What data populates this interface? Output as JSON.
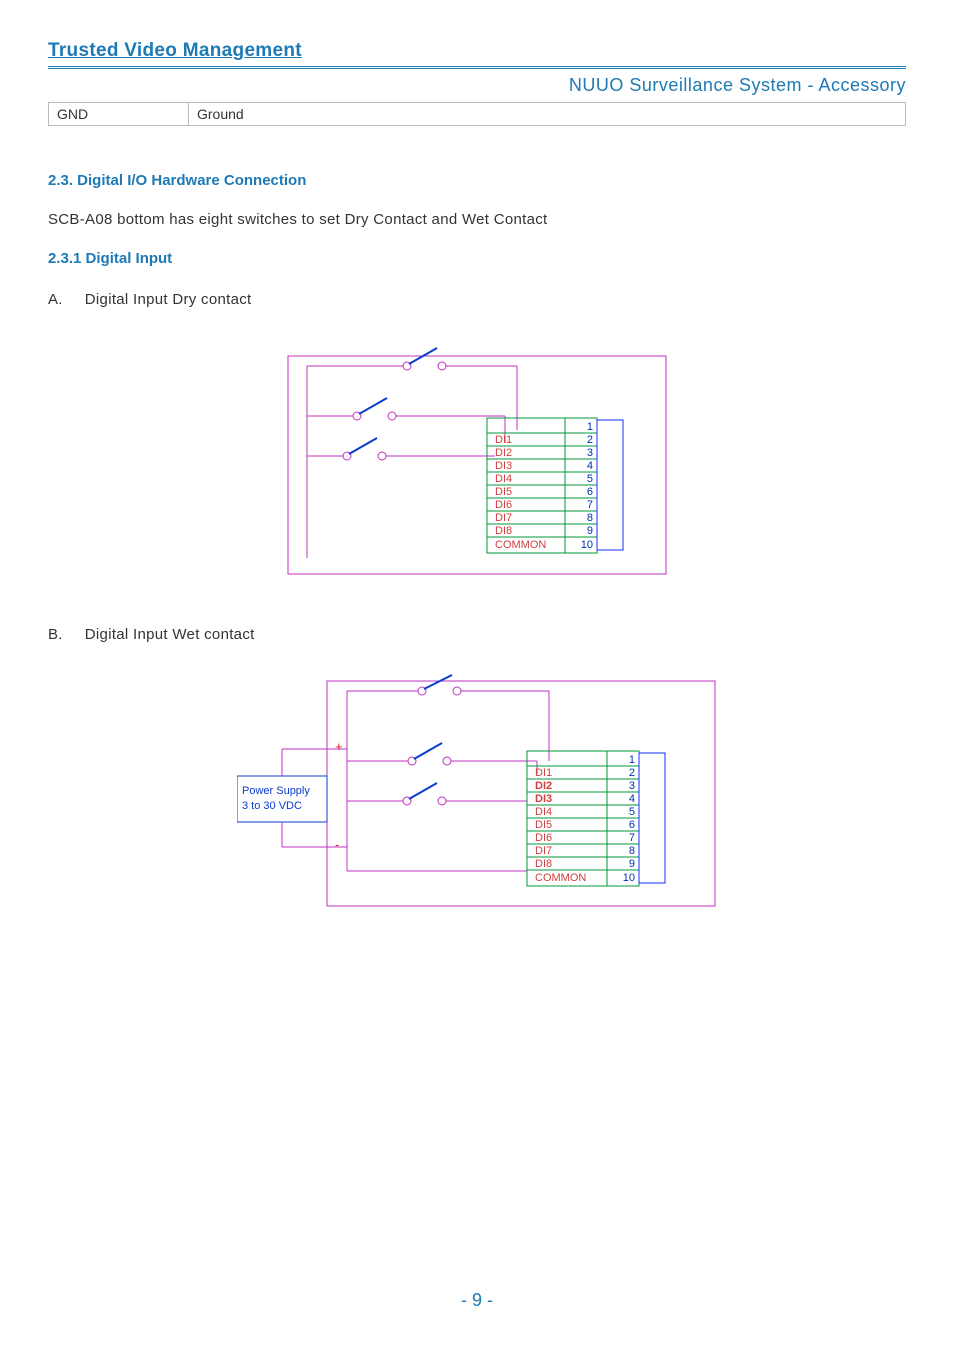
{
  "header": {
    "title": "Trusted Video Management",
    "subtitle": "NUUO Surveillance System - Accessory"
  },
  "gnd_row": {
    "c1": "GND",
    "c2": "Ground"
  },
  "section23": {
    "heading": "2.3. Digital I/O Hardware Connection",
    "body": "SCB-A08 bottom has eight switches to set Dry Contact and Wet Contact"
  },
  "section231": {
    "heading": "2.3.1 Digital Input"
  },
  "itemA": {
    "marker": "A.",
    "text": "Digital Input Dry contact"
  },
  "itemB": {
    "marker": "B.",
    "text": "Digital Input Wet contact"
  },
  "diagram_pins": {
    "labels": [
      "DI1",
      "DI2",
      "DI3",
      "DI4",
      "DI5",
      "DI6",
      "DI7",
      "DI8",
      "COMMON"
    ],
    "numbers": [
      "1",
      "2",
      "3",
      "4",
      "5",
      "6",
      "7",
      "8",
      "9",
      "10"
    ]
  },
  "diagramB": {
    "power_label_l1": "Power Supply",
    "power_label_l2": "3 to 30 VDC",
    "plus": "+",
    "minus": "-"
  },
  "footer": {
    "page": "- 9 -"
  }
}
